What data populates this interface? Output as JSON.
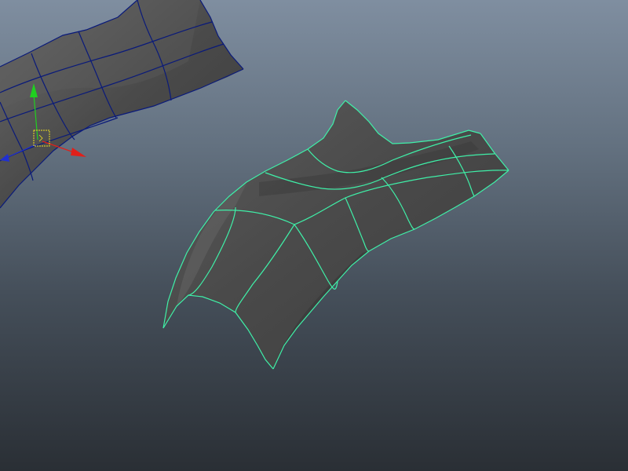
{
  "viewport": {
    "background_top": "#7f8ea0",
    "background_bottom": "#2a2f35"
  },
  "objects": [
    {
      "name": "unselected-nurbs-surface",
      "selected": false,
      "wire_color": "#0a1a7a"
    },
    {
      "name": "selected-nurbs-surface",
      "selected": true,
      "wire_color": "#3ff0a8"
    }
  ],
  "manipulator": {
    "type": "move-tool",
    "axes": [
      {
        "axis": "x",
        "color": "#e0201a",
        "icon": "cone-arrow"
      },
      {
        "axis": "y",
        "color": "#20d020",
        "icon": "cone-arrow"
      },
      {
        "axis": "z",
        "color": "#2030d0",
        "icon": "cone-arrow"
      }
    ],
    "center_color": "#f0e020"
  }
}
